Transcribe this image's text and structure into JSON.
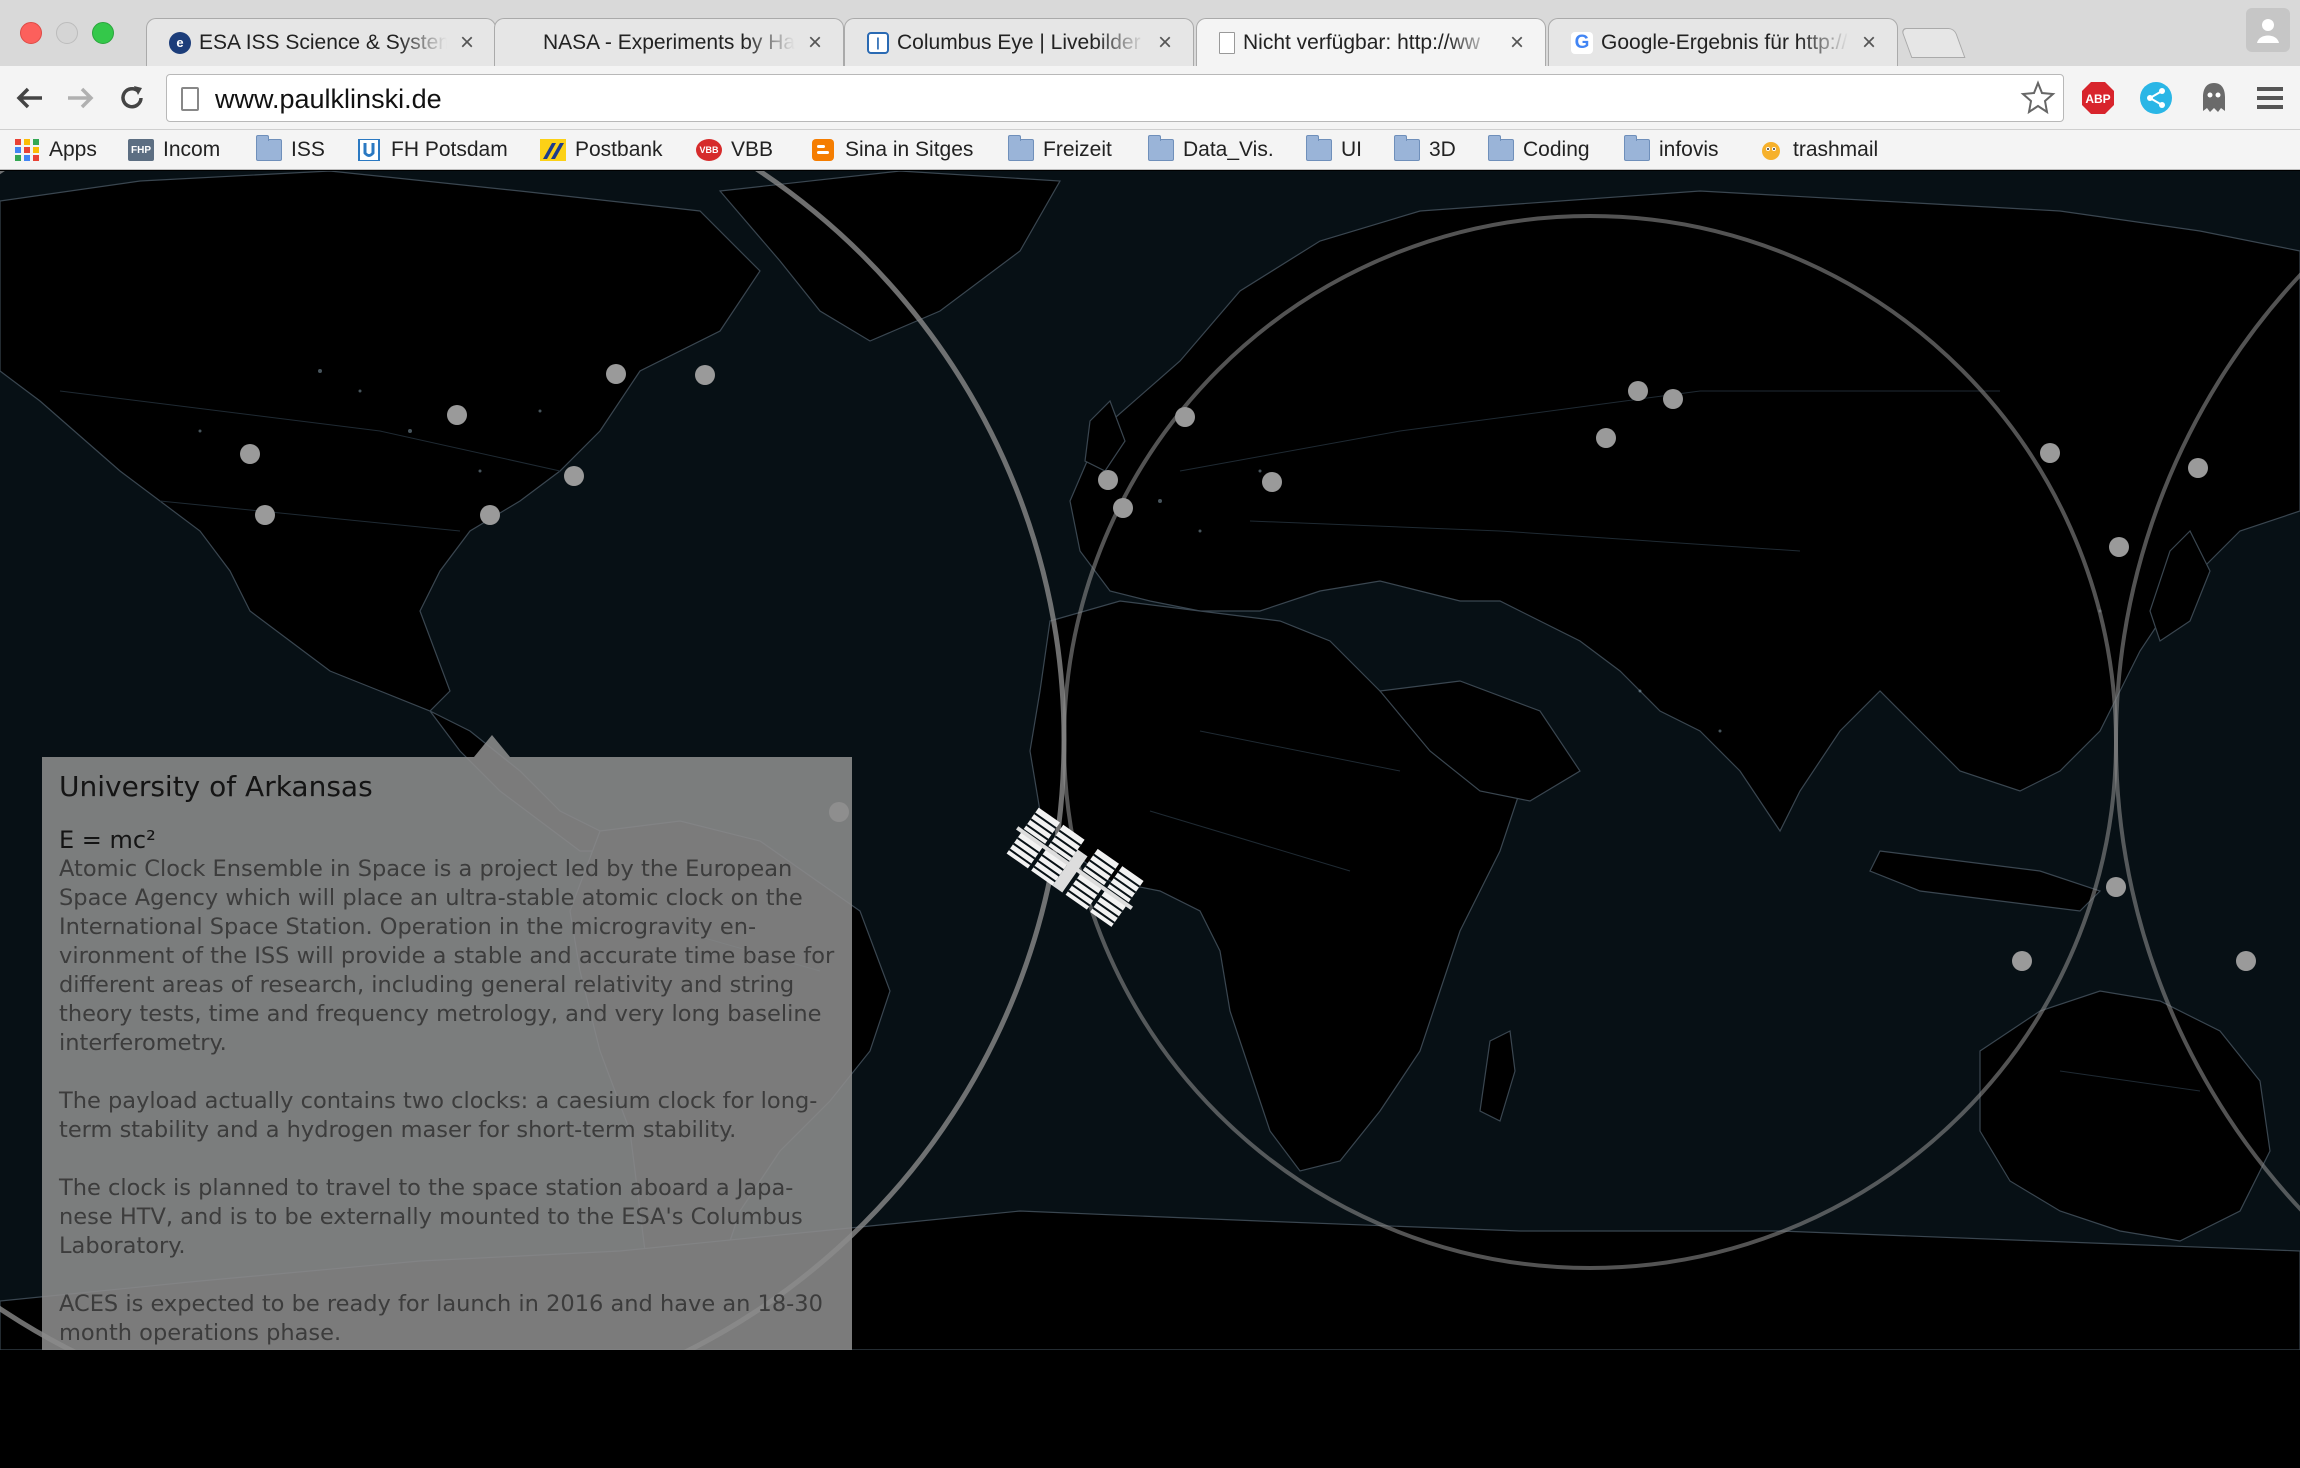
{
  "browser": {
    "tabs": [
      {
        "title": "ESA ISS Science & System",
        "favicon": "esa-icon",
        "color": "#1c3d7a",
        "active": false
      },
      {
        "title": "NASA - Experiments by Ha",
        "favicon": "none",
        "color": "#e6e6e6",
        "active": false
      },
      {
        "title": "Columbus Eye | Livebilder v",
        "favicon": "columbus-icon",
        "color": "#2a6ab3",
        "active": false
      },
      {
        "title": "Nicht verfügbar: http://ww",
        "favicon": "page-icon",
        "color": "#ffffff",
        "active": true
      },
      {
        "title": "Google-Ergebnis für http://",
        "favicon": "google-icon",
        "color": "#4285f4",
        "active": false
      }
    ],
    "url": "www.paulklinski.de",
    "extensions": [
      "adblock-plus-icon",
      "share-icon",
      "ghostery-icon",
      "menu-icon"
    ],
    "adblock_label": "ABP"
  },
  "bookmarks": [
    {
      "label": "Apps",
      "icon": "apps-grid-icon"
    },
    {
      "label": "Incom",
      "icon": "incom-icon",
      "icon_text": "FHP"
    },
    {
      "label": "ISS",
      "icon": "folder-icon"
    },
    {
      "label": "FH Potsdam",
      "icon": "fh-potsdam-icon"
    },
    {
      "label": "Postbank",
      "icon": "postbank-icon"
    },
    {
      "label": "VBB",
      "icon": "vbb-icon",
      "icon_text": "VBB"
    },
    {
      "label": "Sina in Sitges",
      "icon": "blogger-icon"
    },
    {
      "label": "Freizeit",
      "icon": "folder-icon"
    },
    {
      "label": "Data_Vis.",
      "icon": "folder-icon"
    },
    {
      "label": "UI",
      "icon": "folder-icon"
    },
    {
      "label": "3D",
      "icon": "folder-icon"
    },
    {
      "label": "Coding",
      "icon": "folder-icon"
    },
    {
      "label": "infovis",
      "icon": "folder-icon"
    },
    {
      "label": "trashmail",
      "icon": "trashmail-icon"
    }
  ],
  "map": {
    "background_color": "#071015",
    "land_color": "#000000",
    "marker_color": "#9a9a9a",
    "orbit_ring_color": "#8a8a8a",
    "iss_icon": "iss-station-icon"
  },
  "info_panel": {
    "title": "University of Arkansas",
    "formula": "E = mc²",
    "paragraphs": [
      "Atomic Clock Ensemble in Space is a project led by the European Space Agency which will place an ultra-stable atomic clock on the International Space Station. Operation in the microgravity en-vironment of the ISS will provide a stable and accurate time base for different areas of research, including general relativity and string theory tests, time and frequency metrology, and very long baseline interferometry.",
      "The payload actually contains two clocks: a caesium clock for long-term stability and a hydrogen maser for short-term stability.",
      "The clock is planned to travel to the space station aboard a Japa-nese HTV, and is to be externally mounted to the ESA's Columbus Laboratory.",
      "ACES is expected to be ready for launch in 2016 and have an 18-30 month operations phase."
    ]
  }
}
